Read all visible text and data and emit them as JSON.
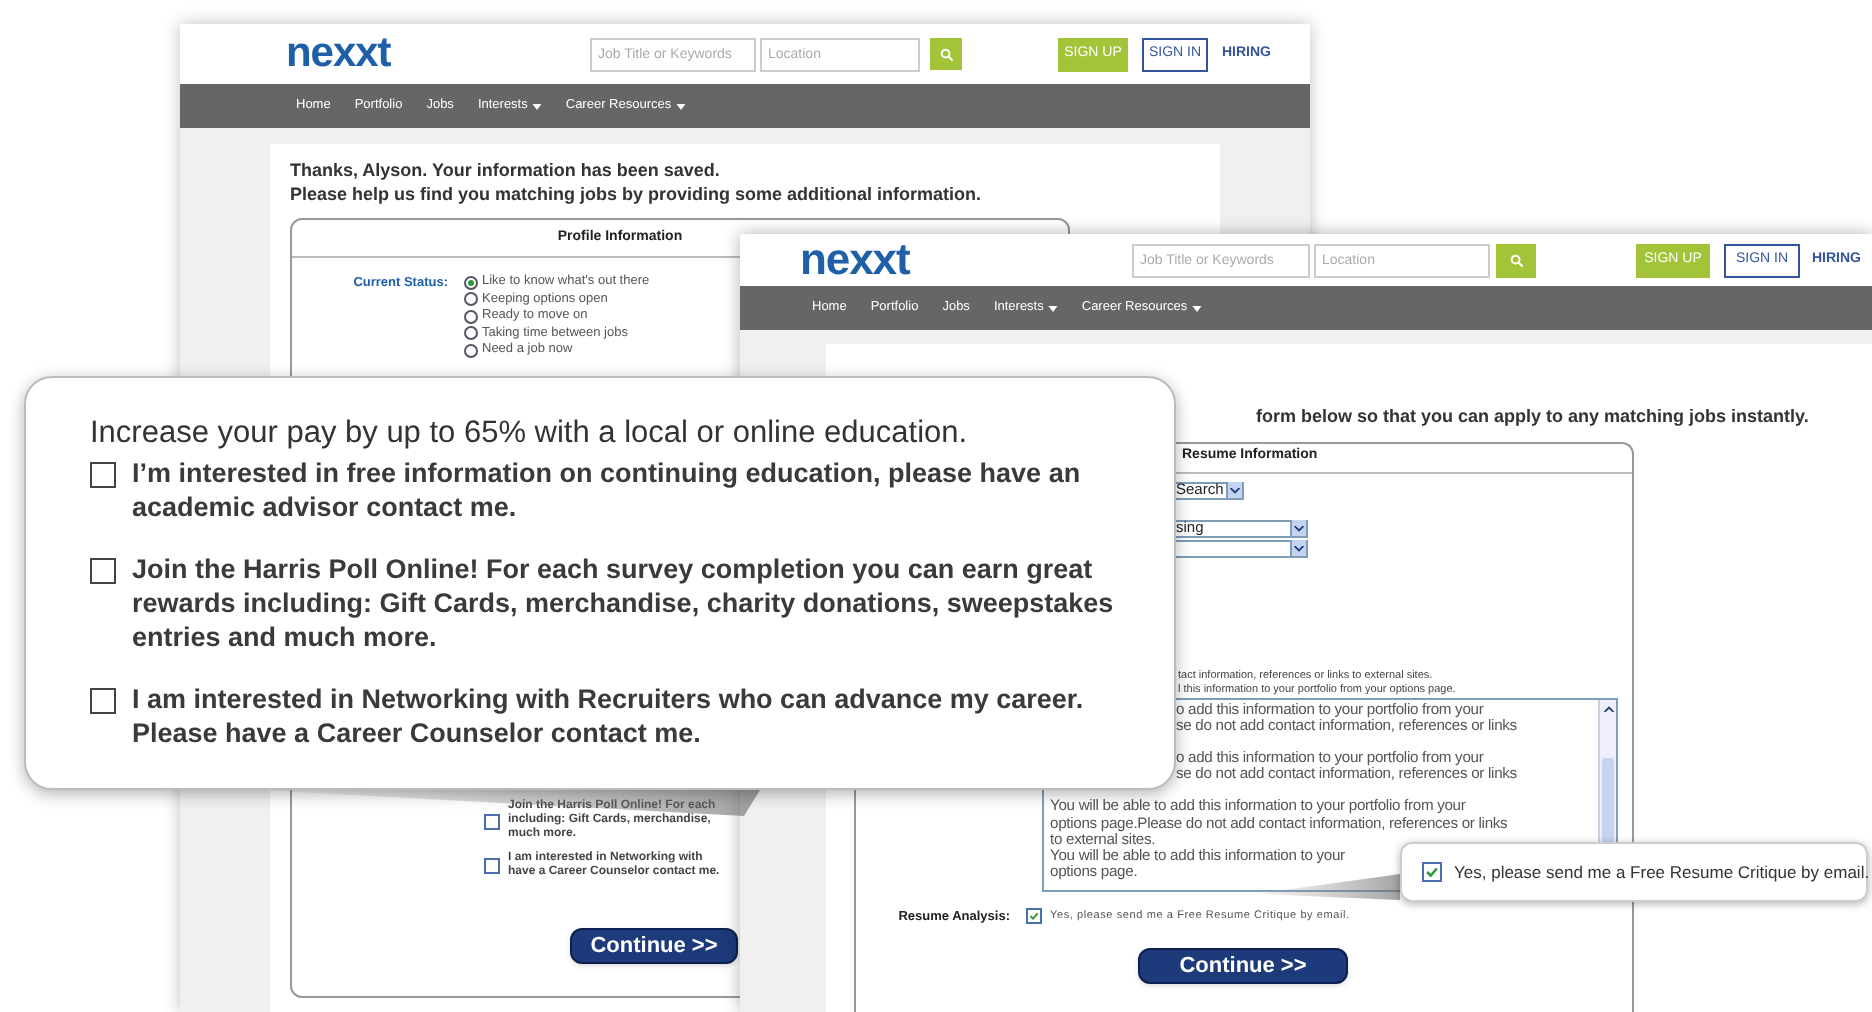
{
  "back_page": {
    "header": {
      "logo": "nexxt",
      "search_placeholder": "Job Title or Keywords",
      "location_placeholder": "Location",
      "sign_up": "SIGN UP",
      "sign_in": "SIGN IN",
      "hiring": "HIRING"
    },
    "nav": [
      {
        "label": "Home",
        "has_menu": false
      },
      {
        "label": "Portfolio",
        "has_menu": false
      },
      {
        "label": "Jobs",
        "has_menu": false
      },
      {
        "label": "Interests",
        "has_menu": true
      },
      {
        "label": "Career Resources",
        "has_menu": true
      }
    ],
    "messages": [
      "Thanks, Alyson. Your information has been saved.",
      "Please help us find you matching jobs by providing some additional information."
    ],
    "panel": {
      "title": "Profile Information",
      "status_label": "Current Status:",
      "status_options": [
        {
          "label": "Like to know what's out there",
          "selected": true
        },
        {
          "label": "Keeping options open",
          "selected": false
        },
        {
          "label": "Ready to move on",
          "selected": false
        },
        {
          "label": "Taking time between jobs",
          "selected": false
        },
        {
          "label": "Need a job now",
          "selected": false
        }
      ],
      "checkboxes": [
        {
          "lines": [
            "Join the Harris Poll Online! For each",
            "including: Gift Cards, merchandise,",
            "much more."
          ],
          "checked": false
        },
        {
          "lines": [
            "I am interested in Networking with",
            "have a Career Counselor contact me."
          ],
          "checked": false
        }
      ],
      "continue": "Continue >>"
    }
  },
  "front_page": {
    "header": {
      "logo": "nexxt",
      "search_placeholder": "Job Title or Keywords",
      "location_placeholder": "Location",
      "sign_up": "SIGN UP",
      "sign_in": "SIGN IN",
      "hiring": "HIRING"
    },
    "nav": [
      {
        "label": "Home",
        "has_menu": false
      },
      {
        "label": "Portfolio",
        "has_menu": false
      },
      {
        "label": "Jobs",
        "has_menu": false
      },
      {
        "label": "Interests",
        "has_menu": true
      },
      {
        "label": "Career Resources",
        "has_menu": true
      }
    ],
    "message": "form below so that you can apply to any matching jobs instantly.",
    "panel": {
      "title": "Resume Information",
      "selects": [
        {
          "kind": "short",
          "value": "Search"
        },
        {
          "kind": "wide",
          "value": "sing"
        },
        {
          "kind": "wide"
        }
      ],
      "notes": [
        "tact information, references or links to external sites.",
        "l this information to your portfolio from your options page."
      ],
      "textarea_paragraphs": [
        {
          "kind": "partial",
          "lines": [
            "o add this information to your portfolio from your",
            "se do not add contact information, references or links"
          ]
        },
        {
          "kind": "partial",
          "lines": [
            "o add this information to your portfolio from your",
            "se do not add contact information, references or links"
          ]
        },
        {
          "kind": "full",
          "lines": [
            "You will be able to add this information to your portfolio from your",
            "options page.Please do not add contact information, references or links",
            "to external sites.",
            "You will be able to add this information to your",
            "options page."
          ]
        }
      ],
      "analysis_label": "Resume Analysis:",
      "analysis_checkbox": {
        "label": "Yes, please send me a Free Resume Critique by email.",
        "checked": true
      },
      "continue": "Continue >>"
    }
  },
  "callout": {
    "heading": "Increase your pay by up to 65% with a local or online education.",
    "options": [
      {
        "label": "I’m interested in free information on continuing education, please have an academic advisor contact me.",
        "checked": false
      },
      {
        "label": "Join the Harris Poll Online! For each survey completion you can earn great rewards including: Gift Cards, merchandise, charity donations, sweepstakes entries and much more.",
        "checked": false
      },
      {
        "label": "I am interested in Networking with Recruiters who can advance my career. Please have a Career Counselor contact me.",
        "checked": false
      }
    ]
  },
  "resume_callout": {
    "label": "Yes, please send me a Free Resume Critique by email.",
    "checked": true
  }
}
